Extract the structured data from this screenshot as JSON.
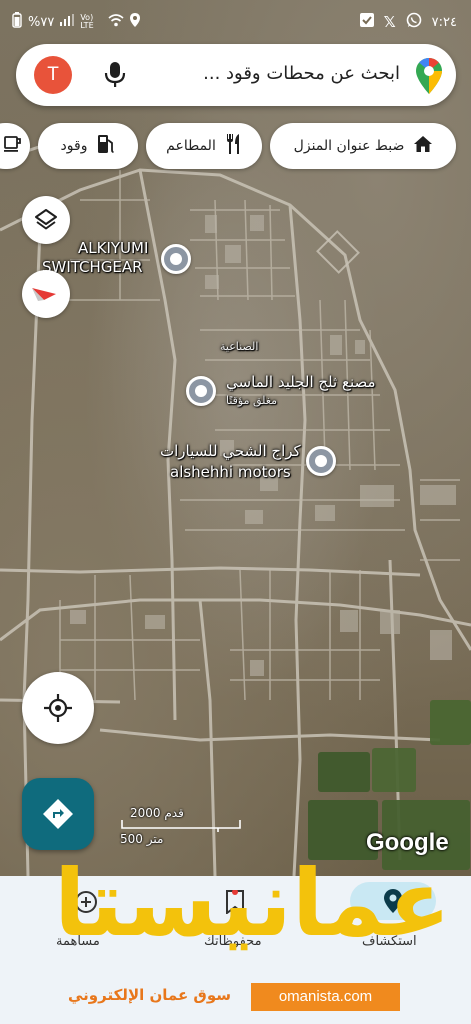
{
  "status_bar": {
    "time": "٧:٢٤",
    "battery": "%٧٧",
    "net": "Vo) LTE"
  },
  "search": {
    "avatar_letter": "T",
    "placeholder": "ابحث عن محطات وقود ..."
  },
  "chips": [
    {
      "label": "ضبط عنوان المنزل",
      "icon": "home-icon"
    },
    {
      "label": "المطاعم",
      "icon": "fork-knife-icon"
    },
    {
      "label": "وقود",
      "icon": "fuel-pump-icon"
    },
    {
      "label": "",
      "icon": "coffee-icon"
    }
  ],
  "map": {
    "places": [
      {
        "name_line1": "ALKIYUMI",
        "name_line2": "SWITCHGEAR"
      },
      {
        "name": "مصنع ثلج الجليد الماسي",
        "sub": "مغلق مؤقتًا"
      },
      {
        "name_line1": "كراج الشحي للسيارات",
        "name_line2": "alshehhi motors"
      }
    ],
    "area_label": "الصناعية",
    "scale": {
      "feet": "2000 قدم",
      "meters": "500 متر"
    },
    "attribution": "Google"
  },
  "bottom_nav": {
    "explore": "استكشاف",
    "saved": "محفوظاتك",
    "contribute": "مساهمة"
  },
  "watermark": {
    "word": "عمانيستا",
    "subtitle": "سوق عمان الإلكتروني",
    "url": "omanista.com"
  },
  "colors": {
    "accent_teal": "#0f6b7d",
    "avatar": "#e8533a",
    "watermark_yellow": "#f3c20c",
    "watermark_orange": "#f08a1e"
  }
}
